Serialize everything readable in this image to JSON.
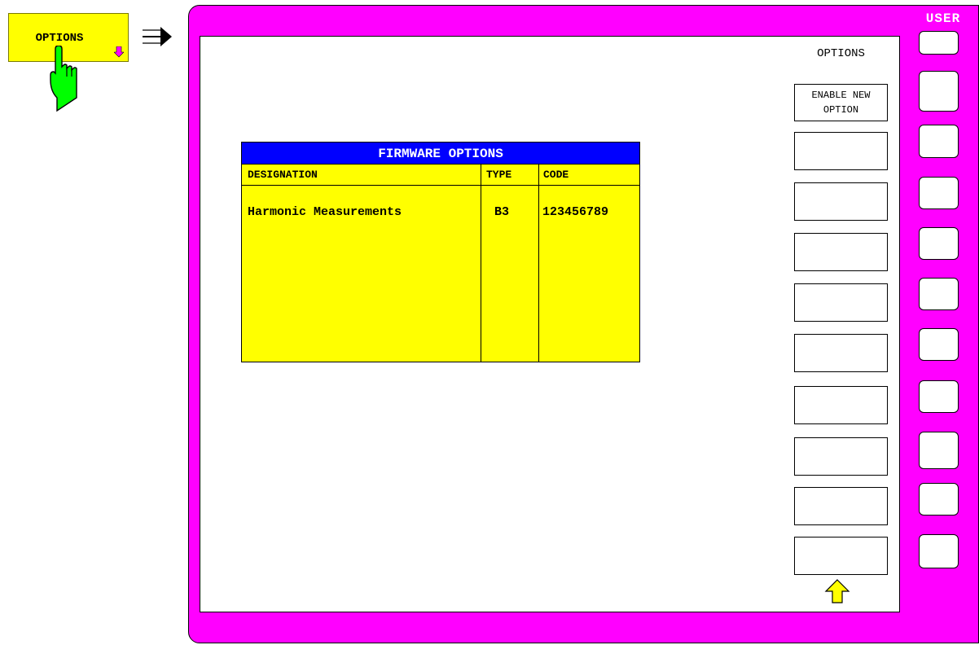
{
  "hardkey": {
    "label": "OPTIONS"
  },
  "softkey_panel": {
    "title": "OPTIONS",
    "softkeys": [
      {
        "label": "ENABLE NEW\nOPTION"
      },
      {
        "label": ""
      },
      {
        "label": ""
      },
      {
        "label": ""
      },
      {
        "label": ""
      },
      {
        "label": ""
      },
      {
        "label": ""
      },
      {
        "label": ""
      },
      {
        "label": ""
      },
      {
        "label": ""
      }
    ]
  },
  "user_label": "USER",
  "table": {
    "title": "FIRMWARE OPTIONS",
    "columns": [
      "DESIGNATION",
      "TYPE",
      "CODE"
    ],
    "rows": [
      [
        "Harmonic Measurements",
        "B3",
        "123456789"
      ]
    ]
  },
  "colors": {
    "frame": "#ff00ff",
    "table_background": "#ffff00",
    "table_title_background": "#0000ff",
    "hand": "#00ff00"
  }
}
